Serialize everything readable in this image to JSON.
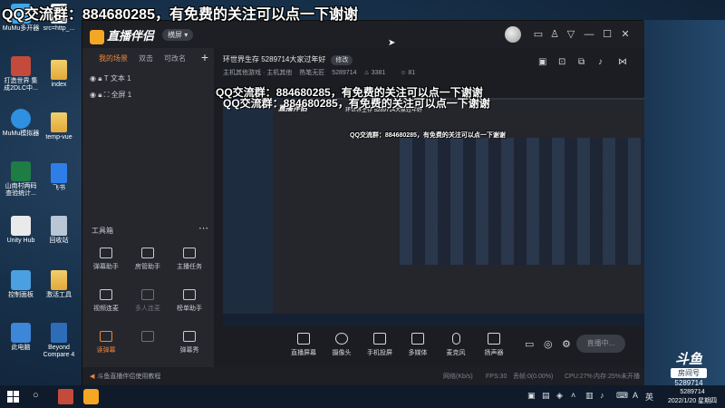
{
  "overlay": {
    "top_text": "QQ交流群：884680285，有免费的关注可以点一下谢谢",
    "mid_text": "QQ交流群：884680285，有免费的关注可以点一下谢谢"
  },
  "desktop": {
    "left_icons": [
      {
        "label": "MuMu多开器",
        "icon": "mumu-multi-icon"
      },
      {
        "label": "打造世界 集成2DLC中...",
        "icon": "game-icon"
      },
      {
        "label": "MuMu模拟器",
        "icon": "mumu-emulator-icon"
      },
      {
        "label": "山南村两码 查验统计...",
        "icon": "excel-icon"
      },
      {
        "label": "Unity Hub",
        "icon": "unity-icon"
      },
      {
        "label": "控制面板",
        "icon": "control-panel-icon"
      },
      {
        "label": "此电脑",
        "icon": "computer-icon"
      }
    ],
    "second_icons": [
      {
        "label": "src=http_...",
        "icon": "file-icon"
      },
      {
        "label": "index",
        "icon": "folder-icon"
      },
      {
        "label": "temp-vue",
        "icon": "folder-icon"
      },
      {
        "label": "飞书",
        "icon": "feishu-icon"
      },
      {
        "label": "回收站",
        "icon": "recycle-bin-icon"
      },
      {
        "label": "激活工具",
        "icon": "folder-icon"
      },
      {
        "label": "Beyond Compare 4",
        "icon": "beyond-compare-icon"
      }
    ]
  },
  "app": {
    "logo_text": "直播伴侣",
    "mode_pill": "横屏",
    "left_panel": {
      "tabs": [
        "我的场景",
        "双击",
        "可改名"
      ],
      "layers": [
        "文本 1",
        "全屏 1"
      ],
      "tools_title": "工具箱",
      "tools": [
        {
          "label": "弹幕助手",
          "state": "normal"
        },
        {
          "label": "房管助手",
          "state": "normal"
        },
        {
          "label": "主播任务",
          "state": "normal"
        },
        {
          "label": "视频连麦",
          "state": "normal"
        },
        {
          "label": "多人连麦",
          "state": "dim"
        },
        {
          "label": "榜单助手",
          "state": "normal"
        },
        {
          "label": "读弹幕",
          "state": "highlight"
        },
        {
          "label": "",
          "state": "dim"
        },
        {
          "label": "弹幕秀",
          "state": "normal"
        }
      ]
    },
    "stream": {
      "title": "环世界生存 5289714大家过年好",
      "edit_label": "修改",
      "category": "主机其他游戏 · 主机其他",
      "account": "热笔无匠",
      "room_id": "5289714",
      "fans": "3381",
      "followers": "81"
    },
    "toolbar": [
      {
        "label": "直播屏幕",
        "icon": "screen-icon"
      },
      {
        "label": "摄像头",
        "icon": "camera-icon"
      },
      {
        "label": "手机投屏",
        "icon": "phone-cast-icon"
      },
      {
        "label": "多媒体",
        "icon": "media-icon"
      },
      {
        "label": "麦克风",
        "icon": "microphone-icon"
      },
      {
        "label": "扬声器",
        "icon": "speaker-icon"
      }
    ],
    "go_live_label": "直播中...",
    "status": {
      "tip": "斗鱼直播伴侣使用教程",
      "network": "网络(Kb/s)",
      "fps": "FPS:30",
      "dropped": "丢帧:0(0.00%)",
      "cpu": "CPU:27%",
      "memory": "内存:25%",
      "duration": "未开播"
    }
  },
  "room_badge": {
    "brand": "斗鱼",
    "label": "房间号",
    "room_number": "5289714"
  },
  "taskbar": {
    "tray_icons": [
      "up-arrow-icon",
      "shield-icon",
      "network-icon",
      "volume-icon",
      "ime-icon"
    ],
    "ime": "A",
    "lang": "英",
    "time": "5289714",
    "date": "2022/1/20 星期四"
  }
}
